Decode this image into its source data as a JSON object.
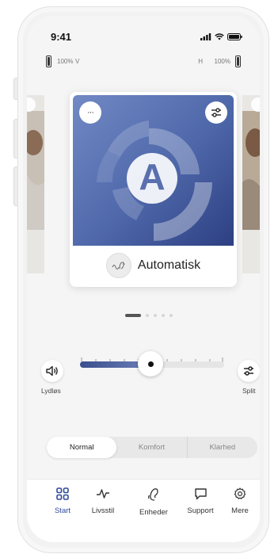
{
  "status": {
    "time": "9:41"
  },
  "battery": {
    "left_pct": "100%",
    "left_side": "V",
    "right_side": "H",
    "right_pct": "100%"
  },
  "program_card": {
    "name": "Automatisk",
    "letter": "A",
    "more_glyph": "···"
  },
  "volume": {
    "mute_label": "Lydløs",
    "split_label": "Split",
    "level": 0.49
  },
  "pagination": {
    "count": 5,
    "active": 0
  },
  "sound_modes": {
    "options": [
      "Normal",
      "Komfort",
      "Klarhed"
    ],
    "selected": "Normal"
  },
  "tabs": [
    {
      "label": "Start",
      "icon": "grid-icon",
      "active": true
    },
    {
      "label": "Livsstil",
      "icon": "activity-icon",
      "active": false
    },
    {
      "label": "Enheder",
      "icon": "hearing-aid-icon",
      "active": false
    },
    {
      "label": "Support",
      "icon": "chat-icon",
      "active": false
    },
    {
      "label": "Mere",
      "icon": "gear-icon",
      "active": false
    }
  ],
  "colors": {
    "accent": "#2f4a9a",
    "card_gradient_start": "#7189c4",
    "card_gradient_end": "#2c3f82"
  }
}
